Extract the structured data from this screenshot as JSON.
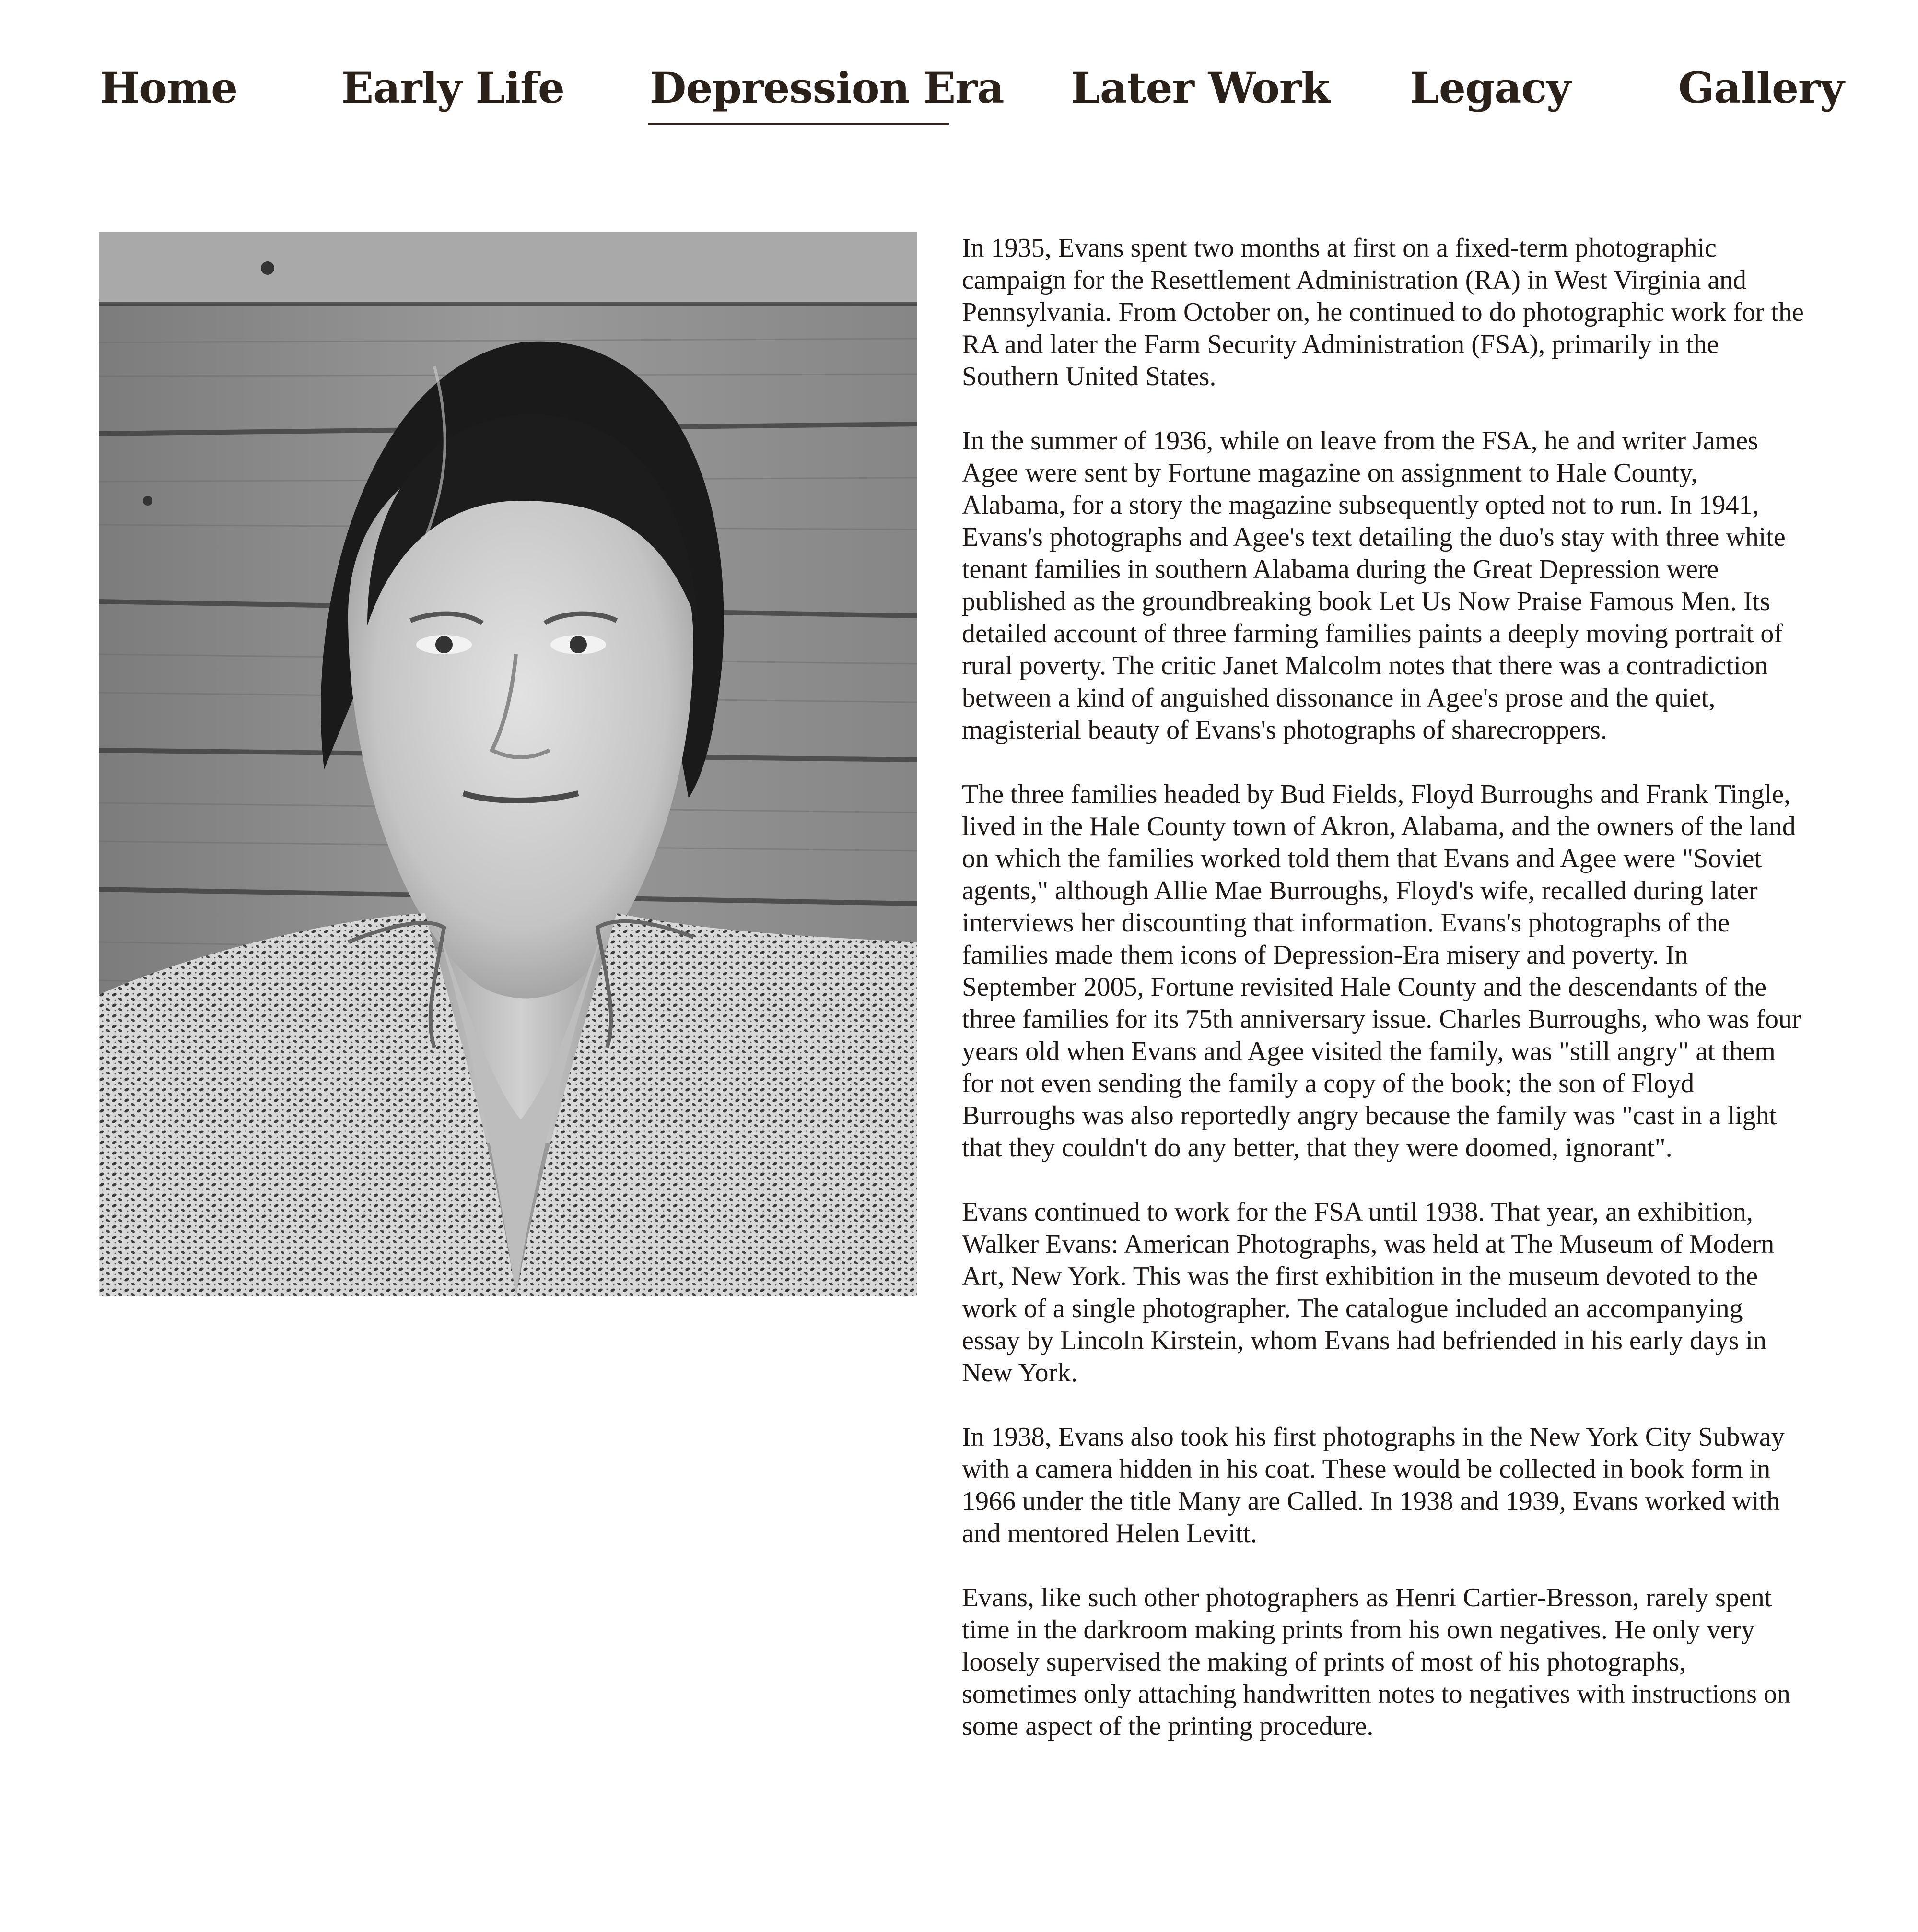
{
  "nav": {
    "items": [
      {
        "label": "Home"
      },
      {
        "label": "Early Life"
      },
      {
        "label": "Depression Era"
      },
      {
        "label": "Later Work"
      },
      {
        "label": "Legacy"
      },
      {
        "label": "Gallery"
      }
    ],
    "active": "Depression Era"
  },
  "article": {
    "paragraphs": [
      "In 1935, Evans spent two months at first on a fixed-term photographic campaign for the Resettlement Administration (RA) in West Virginia and Pennsylvania. From October on, he continued to do photographic work for the RA and later the Farm Security Administration (FSA), primarily in the Southern United States.",
      "In the summer of 1936, while on leave from the FSA, he and writer James Agee were sent by Fortune magazine on assignment to Hale County, Alabama, for a story the magazine subsequently opted not to run. In 1941, Evans's photographs and Agee's text detailing the duo's stay with three white tenant families in southern Alabama during the Great Depression were published as the groundbreaking book Let Us Now Praise Famous Men. Its detailed account of three farming families paints a deeply moving portrait of rural poverty. The critic Janet Malcolm notes that there was a contradiction between a kind of anguished dissonance in Agee's prose and the quiet, magisterial beauty of Evans's photographs of sharecroppers.",
      "The three families headed by Bud Fields, Floyd Burroughs and Frank Tingle, lived in the Hale County town of Akron, Alabama, and the owners of the land on which the families worked told them that Evans and Agee were \"Soviet agents,\" although Allie Mae Burroughs, Floyd's wife, recalled during later interviews her discounting that information. Evans's photographs of the families made them icons of Depression-Era misery and poverty. In September 2005, Fortune revisited Hale County and the descendants of the three families for its 75th anniversary issue. Charles Burroughs, who was four years old when Evans and Agee visited the family, was \"still angry\" at them for not even sending the family a copy of the book; the son of Floyd Burroughs was also reportedly angry because the family was \"cast in a light that they couldn't do any better, that they were doomed, ignorant\".",
      "Evans continued to work for the FSA until 1938. That year, an exhibition, Walker Evans: American Photographs, was held at The Museum of Modern Art, New York. This was the first exhibition in the museum devoted to the work of a single photographer. The catalogue included an accompanying essay by Lincoln Kirstein, whom Evans had befriended in his early days in New York.",
      "In 1938, Evans also took his first photographs in the New York City Subway with a camera hidden in his coat. These would be collected in book form in 1966 under the title Many are Called. In 1938 and 1939, Evans worked with and mentored Helen Levitt.",
      "Evans, like such other photographers as Henri Cartier-Bresson, rarely spent time in the darkroom making prints from his own negatives. He only very loosely supervised the making of prints of most of his photographs, sometimes only attaching handwritten notes to negatives with instructions on some aspect of the printing procedure."
    ]
  },
  "colors": {
    "nav_text": "#2b211b",
    "body_text": "#1f1a17",
    "background": "#ffffff"
  }
}
